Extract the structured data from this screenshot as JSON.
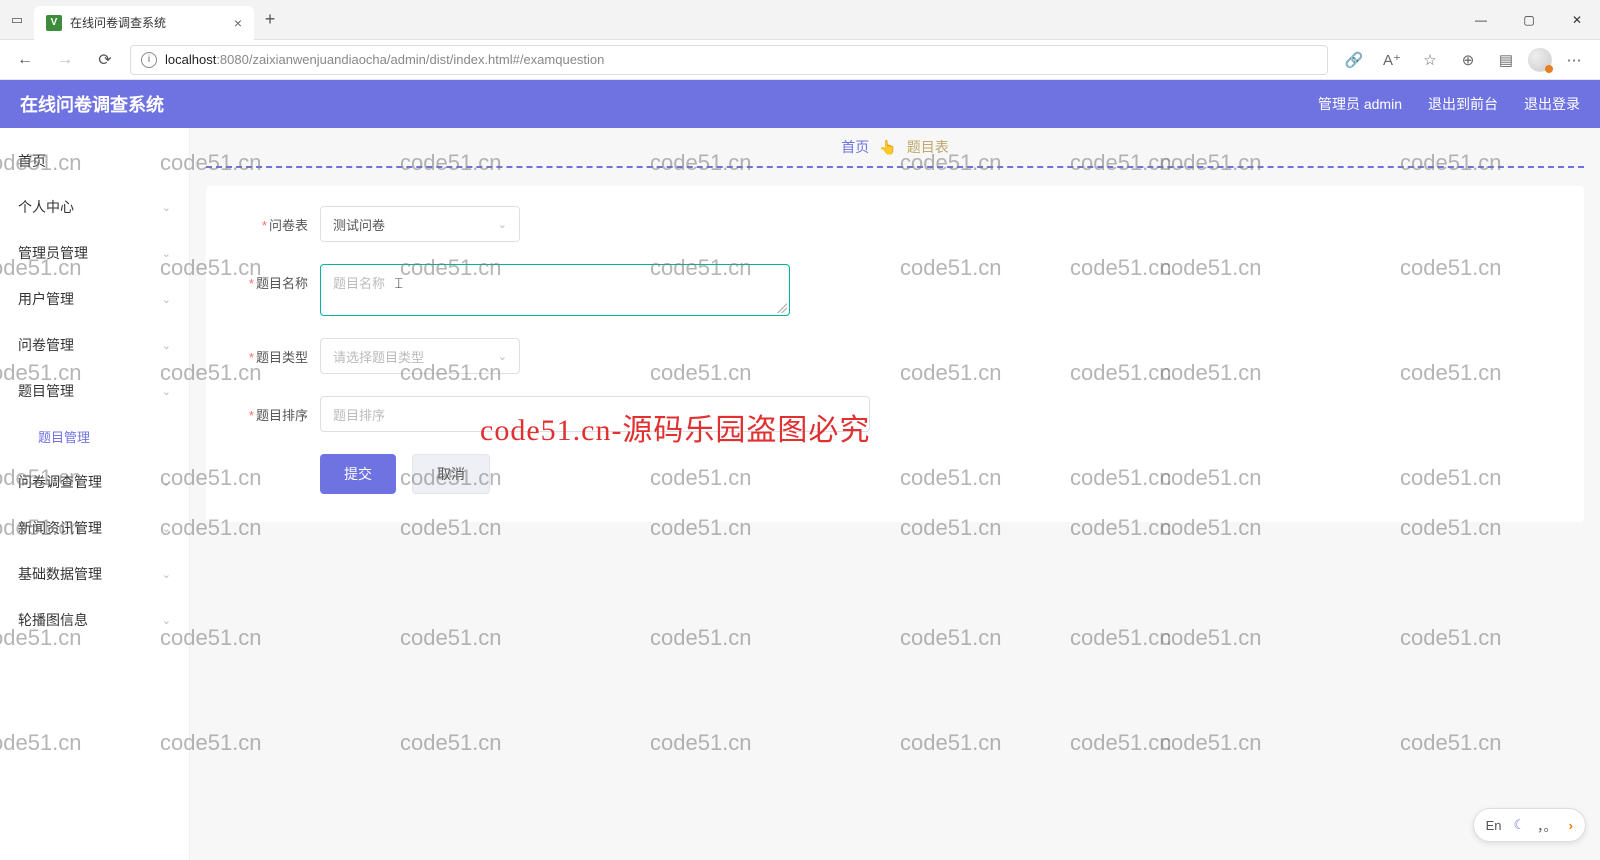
{
  "browser": {
    "tab_title": "在线问卷调查系统",
    "url_host": "localhost",
    "url_path": ":8080/zaixianwenjuandiaocha/admin/dist/index.html#/examquestion"
  },
  "header": {
    "app_title": "在线问卷调查系统",
    "user_label": "管理员 admin",
    "to_front": "退出到前台",
    "logout": "退出登录"
  },
  "sidebar": {
    "items": [
      {
        "label": "首页",
        "expandable": false
      },
      {
        "label": "个人中心",
        "expandable": true
      },
      {
        "label": "管理员管理",
        "expandable": true
      },
      {
        "label": "用户管理",
        "expandable": true
      },
      {
        "label": "问卷管理",
        "expandable": true
      },
      {
        "label": "题目管理",
        "expandable": true,
        "open": true,
        "children": [
          {
            "label": "题目管理"
          }
        ]
      },
      {
        "label": "问卷调查管理",
        "expandable": true
      },
      {
        "label": "新闻资讯管理",
        "expandable": true
      },
      {
        "label": "基础数据管理",
        "expandable": true
      },
      {
        "label": "轮播图信息",
        "expandable": true
      }
    ]
  },
  "breadcrumb": {
    "home": "首页",
    "current": "题目表"
  },
  "form": {
    "paper_label": "问卷表",
    "paper_value": "测试问卷",
    "name_label": "题目名称",
    "name_placeholder": "题目名称",
    "type_label": "题目类型",
    "type_placeholder": "请选择题目类型",
    "order_label": "题目排序",
    "order_placeholder": "题目排序",
    "submit": "提交",
    "cancel": "取消"
  },
  "watermark": {
    "text": "code51.cn",
    "red_text": "code51.cn-源码乐园盗图必究"
  },
  "ime": {
    "lang": "En",
    "comma": "，。"
  }
}
